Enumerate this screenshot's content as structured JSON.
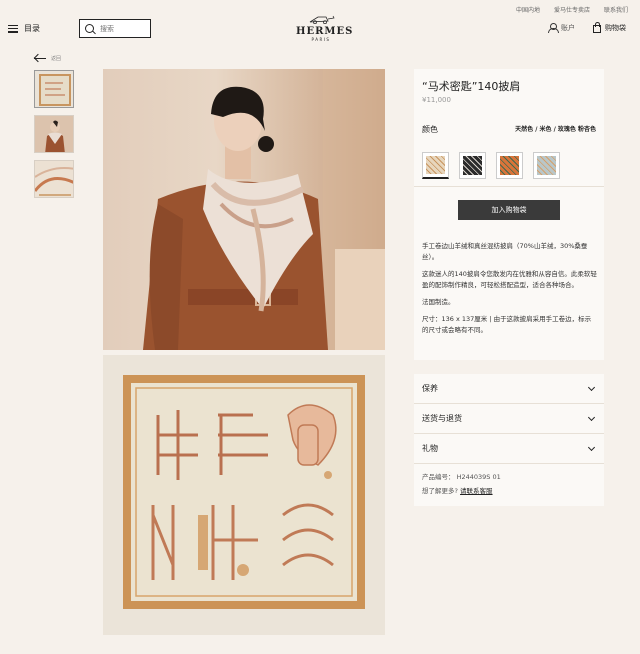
{
  "header": {
    "top_links": [
      "中国内地",
      "爱马仕专卖店",
      "联系我们"
    ],
    "menu_label": "目录",
    "search_placeholder": "搜索",
    "logo_name": "HERMES",
    "logo_sub": "PARIS",
    "account_label": "账户",
    "cart_label": "购物袋"
  },
  "back_label": "返回",
  "gallery": {
    "thumbnails": [
      "scarf",
      "model",
      "scarf-detail"
    ],
    "active_index": 0
  },
  "product": {
    "title": "“马术密匙”140披肩",
    "price": "¥11,000",
    "color_label": "颜色",
    "color_name": "天然色 / 米色 / 玫瑰色 粉杏色",
    "swatches": [
      {
        "name": "natural-beige-rose",
        "base": "#e7d6bd",
        "accent": "#c8955f"
      },
      {
        "name": "black-white",
        "base": "#2b2b2b",
        "accent": "#d9d3cc"
      },
      {
        "name": "orange-green",
        "base": "#d8743a",
        "accent": "#3f6a4f"
      },
      {
        "name": "blue-grey",
        "base": "#b9c7c9",
        "accent": "#d6a06b"
      }
    ],
    "selected_swatch": 0,
    "add_to_bag_label": "加入购物袋",
    "description": [
      "手工卷边山羊绒和真丝混纺披肩（70%山羊绒，30%桑蚕丝）。",
      "这款迷人的140披肩令您散发内在优雅和从容自信。此柔软轻盈的配饰制作精良，可轻松搭配造型，适合各种场合。",
      "法国制造。",
      "尺寸：136 x 137厘米 | 由于这款披肩采用手工卷边，标示的尺寸或会略有不同。"
    ]
  },
  "accordion": {
    "items": [
      "保养",
      "送货与退货",
      "礼物"
    ],
    "product_code_label": "产品编号：",
    "product_code": "H244039S 01",
    "more_text": "想了解更多?",
    "contact_link": "请联系客服"
  },
  "colors": {
    "background": "#f6f1eb",
    "panel": "#fbf9f6",
    "button": "#3a3a3a"
  }
}
